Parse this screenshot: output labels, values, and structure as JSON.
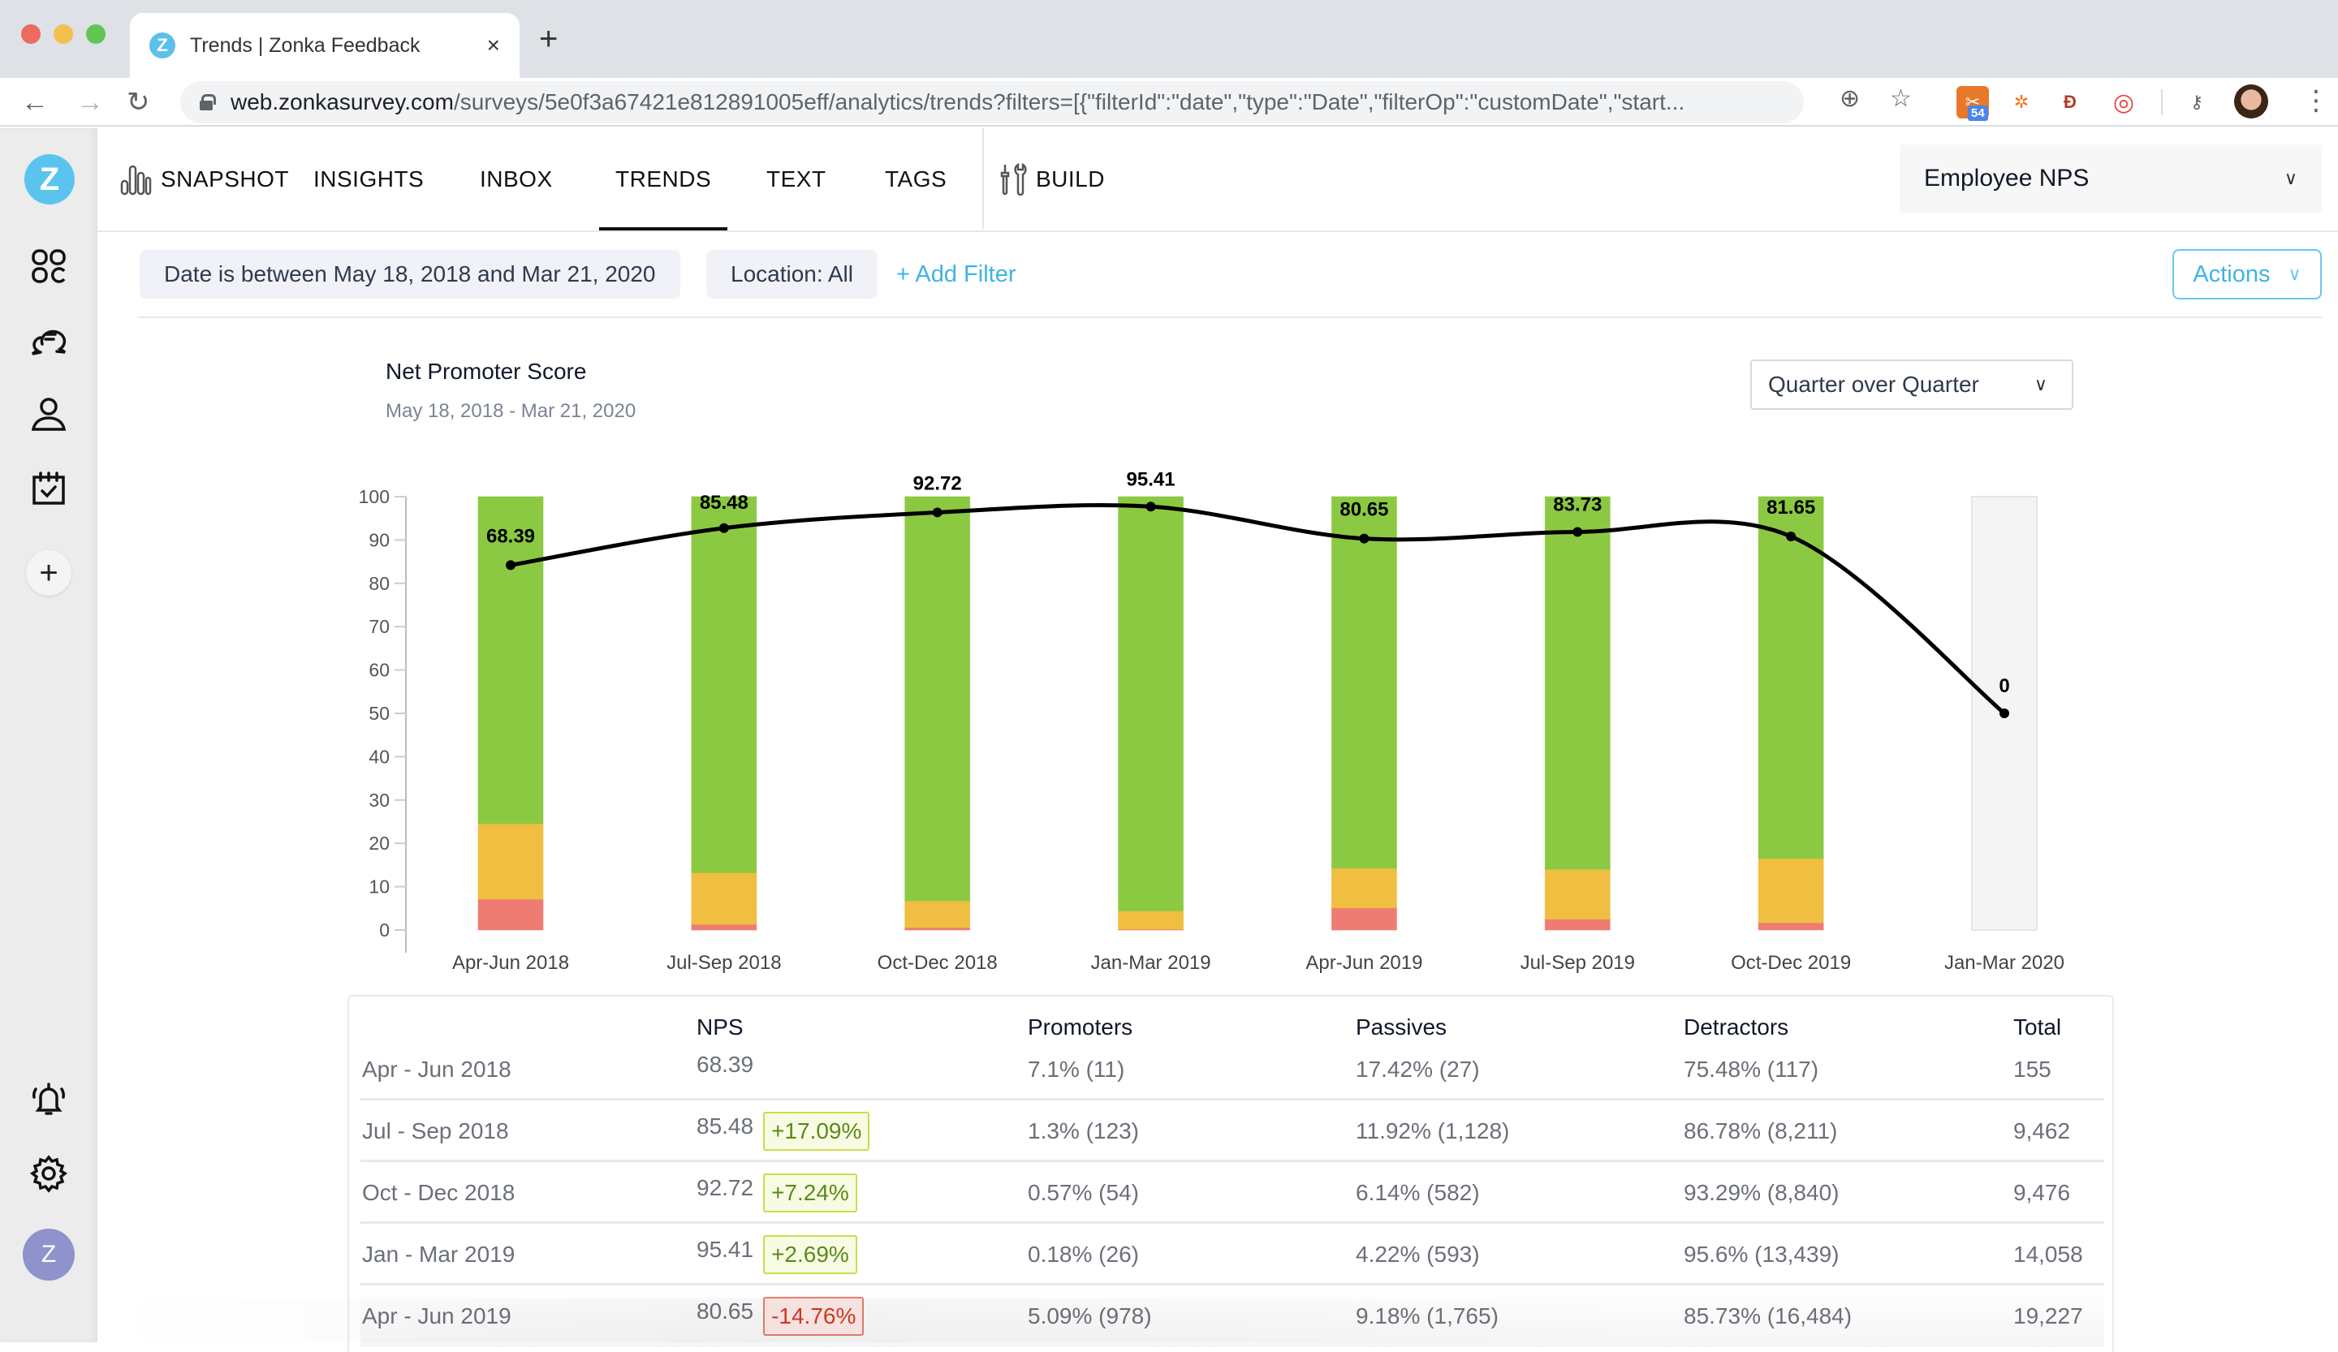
{
  "browser": {
    "tab_title": "Trends | Zonka Feedback",
    "tab_favicon_letter": "Z",
    "close_glyph": "×",
    "new_tab_glyph": "+",
    "url_host": "web.zonkasurvey.com",
    "url_path": "/surveys/5e0f3a67421e812891005eff/analytics/trends?filters=[{\"filterId\":\"date\",\"type\":\"Date\",\"filterOp\":\"customDate\",\"start...",
    "extension_badge": "54",
    "icons": [
      "back-icon",
      "forward-icon",
      "reload-icon",
      "lock-icon",
      "add-to-page-icon",
      "bookmark-star-icon",
      "extension-icon",
      "hubspot-icon",
      "extension-d-icon",
      "extension-spiral-icon",
      "key-icon",
      "profile-avatar",
      "menu-kebab-icon"
    ]
  },
  "sidebar": {
    "logo_letter": "Z",
    "items": [
      {
        "name": "dashboard",
        "icon": "grid-icon"
      },
      {
        "name": "responses",
        "icon": "chat-bubbles-icon"
      },
      {
        "name": "contacts",
        "icon": "user-icon"
      },
      {
        "name": "tasks",
        "icon": "calendar-check-icon"
      }
    ],
    "add_glyph": "+",
    "bottom": [
      {
        "name": "notifications",
        "icon": "bell-icon"
      },
      {
        "name": "settings",
        "icon": "gear-icon"
      }
    ],
    "user_initial": "Z"
  },
  "topnav": {
    "items": [
      {
        "label": "SNAPSHOT",
        "active": false
      },
      {
        "label": "INSIGHTS",
        "active": false
      },
      {
        "label": "INBOX",
        "active": false
      },
      {
        "label": "TRENDS",
        "active": true
      },
      {
        "label": "TEXT",
        "active": false
      },
      {
        "label": "TAGS",
        "active": false
      },
      {
        "label": "BUILD",
        "active": false
      }
    ],
    "survey_select": "Employee NPS",
    "chevron": "∨"
  },
  "filters": {
    "chips": [
      "Date is between May 18, 2018 and Mar 21, 2020",
      "Location: All"
    ],
    "add_filter": "+ Add Filter",
    "actions": "Actions"
  },
  "chart_header": {
    "title": "Net Promoter Score",
    "subtitle": "May 18, 2018 - Mar 21, 2020",
    "period_select": "Quarter over Quarter"
  },
  "colors": {
    "promoters": "#8cc943",
    "passives": "#f0be40",
    "detractors": "#ee7c72",
    "empty_bar": "#f4f4f4",
    "line": "#000000",
    "accent": "#3fb3e5"
  },
  "chart_data": {
    "type": "bar",
    "title": "Net Promoter Score",
    "subtitle": "May 18, 2018 - Mar 21, 2020",
    "xlabel": "",
    "ylabel": "",
    "ylim": [
      0,
      100
    ],
    "yticks": [
      0,
      10,
      20,
      30,
      40,
      50,
      60,
      70,
      80,
      90,
      100
    ],
    "grid": false,
    "legend": "none",
    "stacked": true,
    "categories": [
      "Apr-Jun 2018",
      "Jul-Sep 2018",
      "Oct-Dec 2018",
      "Jan-Mar 2019",
      "Apr-Jun 2019",
      "Jul-Sep 2019",
      "Oct-Dec 2019",
      "Jan-Mar 2020"
    ],
    "series": [
      {
        "name": "Detractors (bar, %)",
        "color": "#ee7c72",
        "values": [
          7.1,
          1.3,
          0.57,
          0.18,
          5.09,
          2.5,
          1.7,
          0
        ]
      },
      {
        "name": "Passives (bar, %)",
        "color": "#f0be40",
        "values": [
          17.42,
          11.92,
          6.14,
          4.22,
          9.18,
          11.5,
          14.8,
          0
        ]
      },
      {
        "name": "Promoters (bar, %)",
        "color": "#8cc943",
        "values": [
          75.48,
          86.78,
          93.29,
          95.6,
          85.73,
          86.0,
          83.5,
          0
        ]
      }
    ],
    "line": {
      "name": "NPS",
      "type": "line",
      "smooth": true,
      "scale": "NPS range -100..100 mapped onto 0..100 axis",
      "values": [
        68.39,
        85.48,
        92.72,
        95.41,
        80.65,
        83.73,
        81.65,
        0
      ],
      "labels": [
        "68.39",
        "85.48",
        "92.72",
        "95.41",
        "80.65",
        "83.73",
        "81.65",
        "0"
      ]
    }
  },
  "table": {
    "headers": [
      "",
      "NPS",
      "Promoters",
      "Passives",
      "Detractors",
      "Total"
    ],
    "rows": [
      {
        "period": "Apr - Jun 2018",
        "nps": "68.39",
        "delta": "",
        "delta_dir": "",
        "promoters": "7.1% (11)",
        "passives": "17.42% (27)",
        "detractors": "75.48% (117)",
        "total": "155"
      },
      {
        "period": "Jul - Sep 2018",
        "nps": "85.48",
        "delta": "+17.09%",
        "delta_dir": "up",
        "promoters": "1.3% (123)",
        "passives": "11.92% (1,128)",
        "detractors": "86.78% (8,211)",
        "total": "9,462"
      },
      {
        "period": "Oct - Dec 2018",
        "nps": "92.72",
        "delta": "+7.24%",
        "delta_dir": "up",
        "promoters": "0.57% (54)",
        "passives": "6.14% (582)",
        "detractors": "93.29% (8,840)",
        "total": "9,476"
      },
      {
        "period": "Jan - Mar 2019",
        "nps": "95.41",
        "delta": "+2.69%",
        "delta_dir": "up",
        "promoters": "0.18% (26)",
        "passives": "4.22% (593)",
        "detractors": "95.6% (13,439)",
        "total": "14,058"
      },
      {
        "period": "Apr - Jun 2019",
        "nps": "80.65",
        "delta": "-14.76%",
        "delta_dir": "down",
        "promoters": "5.09% (978)",
        "passives": "9.18% (1,765)",
        "detractors": "85.73% (16,484)",
        "total": "19,227"
      }
    ]
  }
}
